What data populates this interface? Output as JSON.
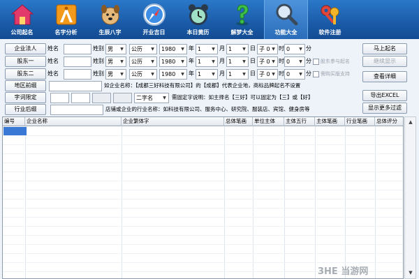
{
  "toolbar": {
    "items": [
      {
        "label": "公司起名",
        "icon": "house-icon",
        "active": false
      },
      {
        "label": "名字分析",
        "icon": "compass-ruler-icon",
        "active": false
      },
      {
        "label": "生辰八字",
        "icon": "dog-zodiac-icon",
        "active": false
      },
      {
        "label": "开业吉日",
        "icon": "safari-compass-icon",
        "active": false
      },
      {
        "label": "本日黄历",
        "icon": "alarm-clock-icon",
        "active": false
      },
      {
        "label": "解梦大全",
        "icon": "question-mark-icon",
        "active": false
      },
      {
        "label": "功能大全",
        "icon": "magnifier-icon",
        "active": true
      },
      {
        "label": "软件注册",
        "icon": "keys-icon",
        "active": false
      }
    ]
  },
  "form": {
    "rows": [
      {
        "button": "企业法人",
        "name_label": "姓名",
        "surname_label": "姓别",
        "gender": "男",
        "calendar": "公历",
        "year": "1980",
        "year_unit": "年",
        "month": "1",
        "month_unit": "月",
        "day": "1",
        "day_unit": "日",
        "hour": "子 0",
        "hour_unit": "时",
        "minute": "0",
        "minute_unit": "分"
      },
      {
        "button": "股东一",
        "name_label": "姓名",
        "surname_label": "姓别",
        "gender": "男",
        "calendar": "公历",
        "year": "1980",
        "year_unit": "年",
        "month": "1",
        "month_unit": "月",
        "day": "1",
        "day_unit": "日",
        "hour": "子 0",
        "hour_unit": "时",
        "minute": "0",
        "minute_unit": "分",
        "option": "股东参与起名"
      },
      {
        "button": "股东二",
        "name_label": "姓名",
        "surname_label": "姓别",
        "gender": "男",
        "calendar": "公历",
        "year": "1980",
        "year_unit": "年",
        "month": "1",
        "month_unit": "月",
        "day": "1",
        "day_unit": "日",
        "hour": "子 0",
        "hour_unit": "时",
        "minute": "0",
        "minute_unit": "分",
        "option": "需购买版支持"
      }
    ],
    "region_button": "地区前缀",
    "region_hint": "如企业名称：【成都三好科技有限公司】的【成都】代表企业地，商标品牌起名不设置",
    "char_button": "字词限定",
    "char_select": "二字名",
    "char_hint": "需固定字说明：如主择名【三好】可以固定为【三】或【好】",
    "industry_button": "行业后缀",
    "industry_hint": "店铺或企业的行业名称：如科技有限公司、服务中心、研究院、服装店、宾馆、健身房等"
  },
  "actions": {
    "start": "马上起名",
    "continue": "继续显示",
    "detail": "查看详细",
    "export": "导出EXCEL",
    "more": "显示更多过滤"
  },
  "grid": {
    "columns": [
      "编号",
      "企业名称",
      "企业繁体字",
      "总体笔画",
      "单位主体",
      "主体五行",
      "主体笔画",
      "行业笔画",
      "总体评分"
    ]
  },
  "watermark": "3HE 当游网"
}
